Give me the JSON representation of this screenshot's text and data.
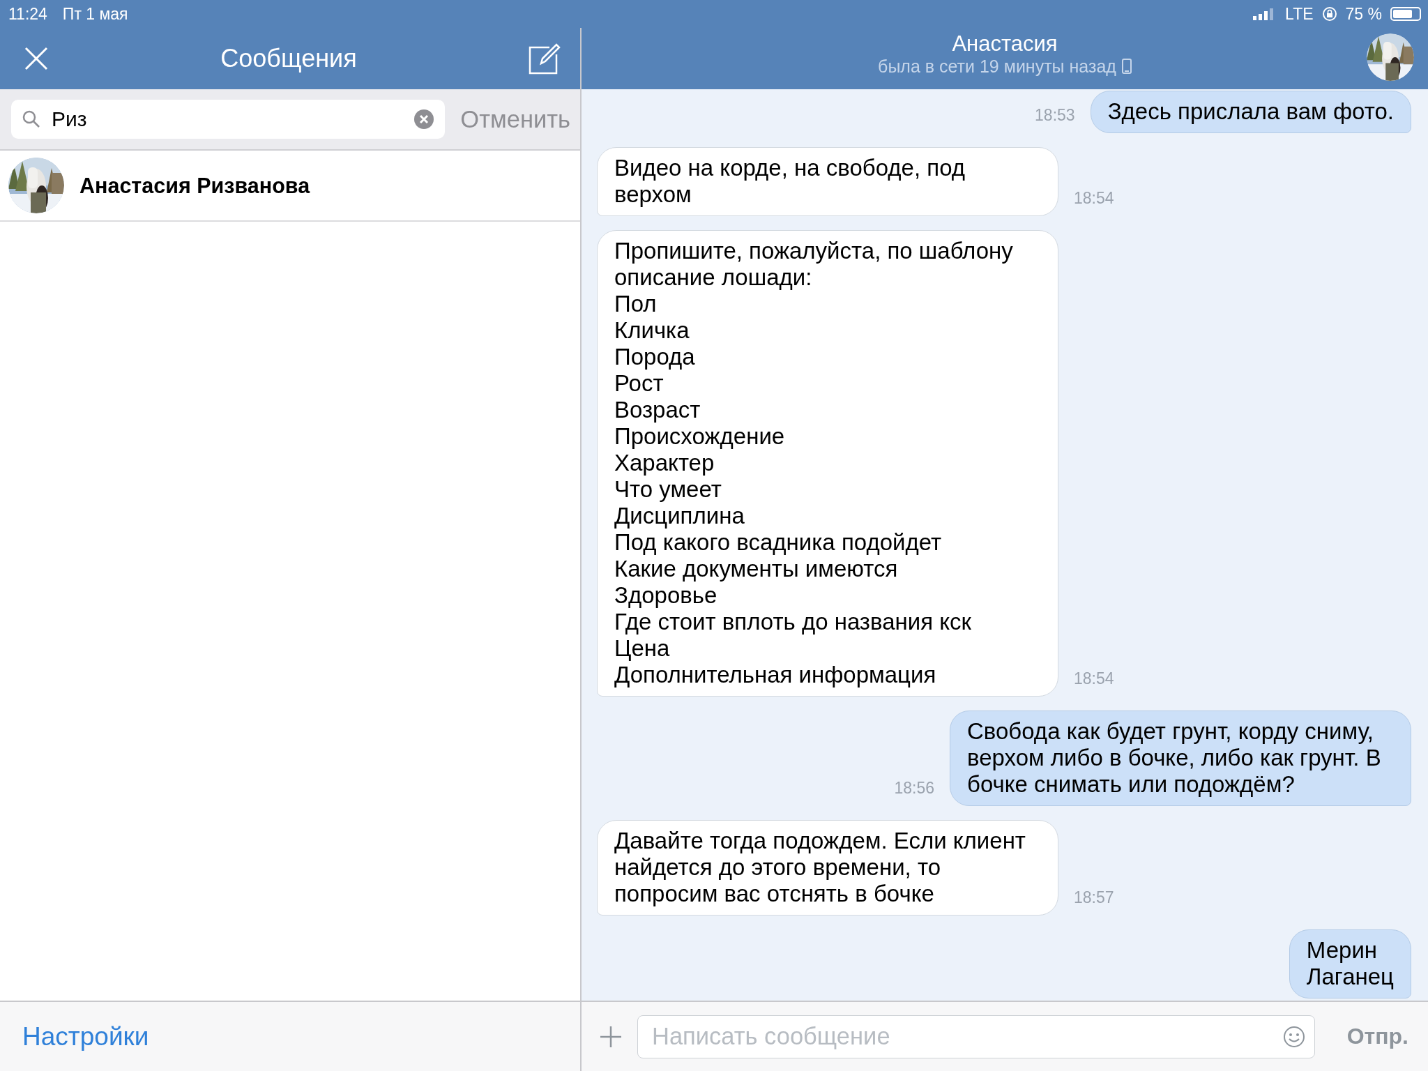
{
  "status_bar": {
    "time": "11:24",
    "date": "Пт 1 мая",
    "network": "LTE",
    "battery": "75 %"
  },
  "sidebar": {
    "title": "Сообщения",
    "search": {
      "value": "Риз",
      "cancel": "Отменить"
    },
    "results": [
      {
        "name": "Анастасия Ризванова"
      }
    ],
    "footer": "Настройки"
  },
  "chat": {
    "title": "Анастасия",
    "subtitle": "была в сети 19 минуты назад",
    "messages": [
      {
        "kind": "outgoing",
        "text": "Здесь прислала вам фото.",
        "time": "18:53"
      },
      {
        "kind": "incoming",
        "text": "Видео на корде, на свободе, под верхом",
        "time": "18:54"
      },
      {
        "kind": "incoming",
        "text": "Пропишите, пожалуйста, по шаблону описание лошади:\nПол\nКличка\nПорода\nРост\nВозраст\nПроисхождение\nХарактер\nЧто умеет\nДисциплина\nПод какого всадника подойдет\nКакие документы имеются\nЗдоровье\nГде стоит вплоть до названия кск\nЦена\nДополнительная информация",
        "time": "18:54"
      },
      {
        "kind": "outgoing",
        "text": "Свобода как будет грунт, корду сниму, верхом либо в бочке, либо как грунт. В бочке снимать или подождём?",
        "time": "18:56"
      },
      {
        "kind": "incoming",
        "text": "Давайте тогда подождем. Если клиент найдется до этого времени, то попросим вас отснять в бочке",
        "time": "18:57"
      },
      {
        "kind": "outgoing",
        "text": "Мерин\nЛаганец"
      }
    ],
    "composer": {
      "placeholder": "Написать сообщение",
      "send": "Отпр."
    }
  }
}
